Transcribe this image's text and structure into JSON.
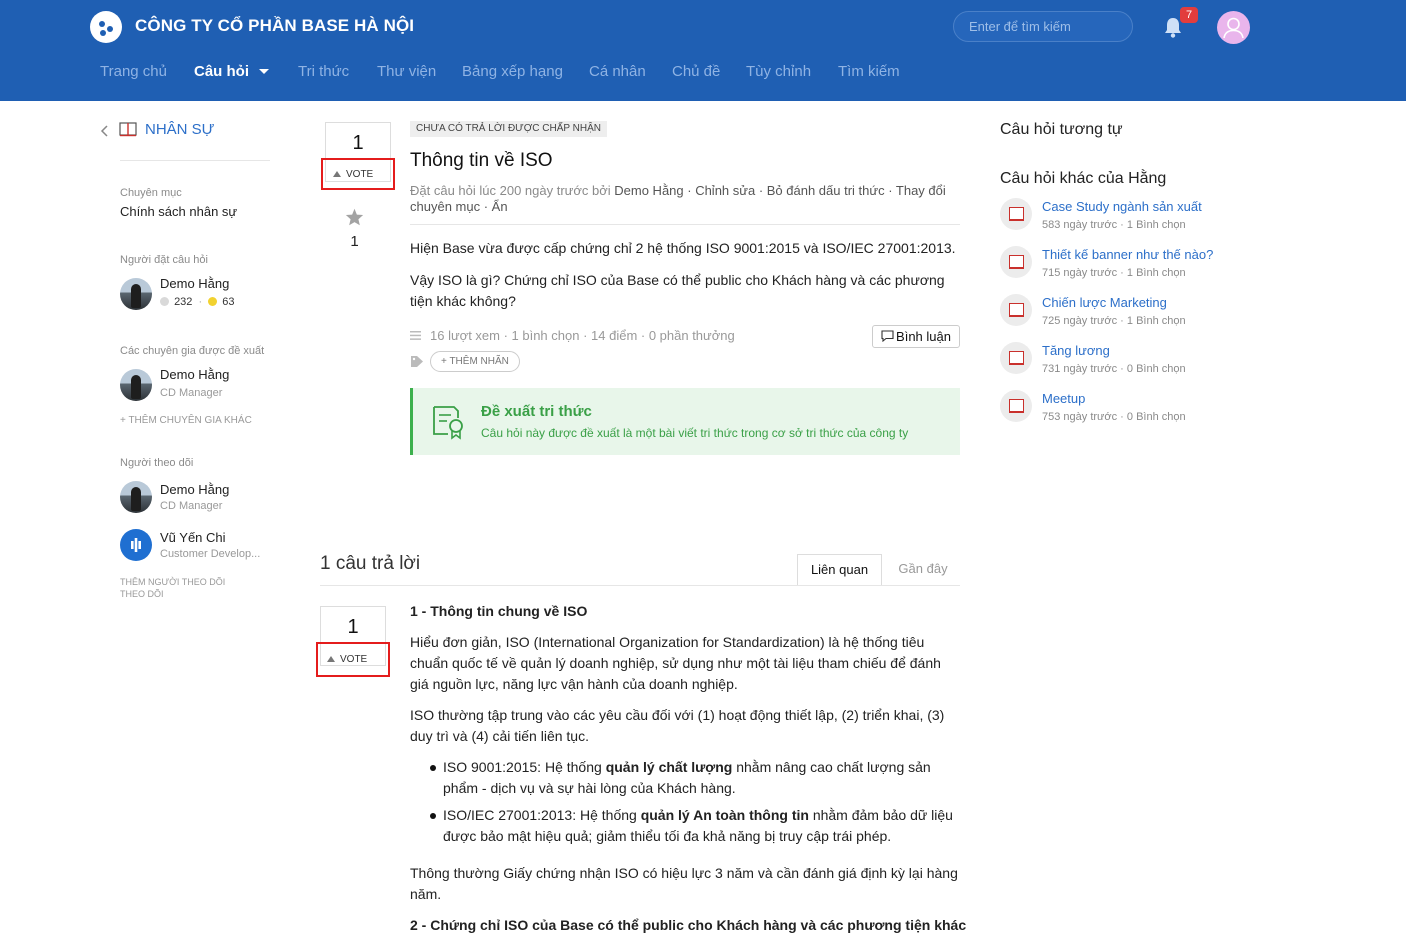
{
  "header": {
    "company": "CÔNG TY CỔ PHẦN BASE HÀ NỘI",
    "search_placeholder": "Enter để tìm kiếm",
    "notification_count": "7",
    "nav": [
      {
        "label": "Trang chủ"
      },
      {
        "label": "Câu hỏi"
      },
      {
        "label": "Tri thức"
      },
      {
        "label": "Thư viện"
      },
      {
        "label": "Bảng xếp hạng"
      },
      {
        "label": "Cá nhân"
      },
      {
        "label": "Chủ đề"
      },
      {
        "label": "Tùy chỉnh"
      },
      {
        "label": "Tìm kiếm"
      }
    ],
    "colors": {
      "bar": "#1f5fb3",
      "badge": "#e23d3d"
    }
  },
  "left": {
    "section_title": "NHÂN SỰ",
    "category_label": "Chuyên mục",
    "category_value": "Chính sách nhân sự",
    "asker_label": "Người đặt câu hỏi",
    "asker": {
      "name": "Demo Hằng",
      "points_a": "232",
      "points_b": "63"
    },
    "experts_label": "Các chuyên gia được đề xuất",
    "expert": {
      "name": "Demo Hằng",
      "role": "CD Manager"
    },
    "add_expert": "+ THÊM CHUYÊN GIA KHÁC",
    "followers_label": "Người theo dõi",
    "followers": [
      {
        "name": "Demo Hằng",
        "role": "CD Manager"
      },
      {
        "name": "Vũ Yến Chi",
        "role": "Customer Develop..."
      }
    ],
    "add_follower_1": "THÊM NGƯỜI THEO DÕI",
    "add_follower_2": "THEO DÕI"
  },
  "question": {
    "vote_count": "1",
    "vote_label": "VOTE",
    "star_count": "1",
    "status": "CHƯA CÓ TRẢ LỜI ĐƯỢC CHẤP NHẬN",
    "title": "Thông tin về ISO",
    "meta_prefix": "Đặt câu hỏi lúc 200 ngày trước bởi",
    "meta_author": "Demo Hằng",
    "meta_actions": " · Chỉnh sửa · Bỏ đánh dấu tri thức · Thay đổi chuyên mục · Ẩn",
    "body_1": "Hiện Base vừa được cấp chứng chỉ 2 hệ thống ISO 9001:2015 và ISO/IEC 27001:2013.",
    "body_2": "Vậy ISO là gì? Chứng chỉ ISO của Base có thể public cho Khách hàng và các phương tiện khác không?",
    "stats": "16 lượt xem · 1 bình chọn · 14 điểm · 0 phần thưởng",
    "comment_label": "Bình luận",
    "add_tag": "+ THÊM NHÃN",
    "suggest_title": "Đề xuất tri thức",
    "suggest_desc": "Câu hỏi này được đề xuất là một bài viết tri thức trong cơ sở tri thức của công ty"
  },
  "answers": {
    "count_label": "1 câu trả lời",
    "tabs": [
      {
        "label": "Liên quan"
      },
      {
        "label": "Gần đây"
      }
    ],
    "vote_count": "1",
    "vote_label": "VOTE",
    "h1": "1 - Thông tin chung về ISO",
    "p1": "Hiểu đơn giản, ISO (International Organization for Standardization) là hệ thống tiêu chuẩn quốc tế về quản lý doanh nghiệp, sử dụng như một tài liệu tham chiếu để đánh giá nguồn lực, năng lực vận hành của doanh nghiệp.",
    "p2": "ISO thường tập trung vào các yêu cầu đối với (1) hoạt động thiết lập, (2) triển khai, (3) duy trì và (4) cải tiến liên tục.",
    "b1_pre": "ISO 9001:2015: Hệ thống ",
    "b1_bold": "quản lý chất lượng",
    "b1_post": " nhằm nâng cao chất lượng sản phẩm - dịch vụ và sự hài lòng của Khách hàng.",
    "b2_pre": "ISO/IEC 27001:2013: Hệ thống ",
    "b2_bold": "quản lý An toàn thông tin",
    "b2_post": " nhằm đảm bảo dữ liệu được bảo mật hiệu quả; giảm thiểu tối đa khả năng bị truy cập trái phép.",
    "p3": "Thông thường Giấy chứng nhận ISO có hiệu lực 3 năm và cần đánh giá định kỳ lại hàng năm.",
    "h2": "2 - Chứng chỉ ISO của Base có thể public cho Khách hàng và các phương tiện khác"
  },
  "right": {
    "similar_title": "Câu hỏi tương tự",
    "other_title": "Câu hỏi khác của Hằng",
    "items": [
      {
        "title": "Case Study ngành sản xuất",
        "meta": "583 ngày trước · 1 Bình chọn"
      },
      {
        "title": "Thiết kế banner như thế nào?",
        "meta": "715 ngày trước · 1 Bình chọn"
      },
      {
        "title": "Chiến lược Marketing",
        "meta": "725 ngày trước · 1 Bình chọn"
      },
      {
        "title": "Tăng lương",
        "meta": "731 ngày trước · 0 Bình chọn"
      },
      {
        "title": "Meetup",
        "meta": "753 ngày trước · 0 Bình chọn"
      }
    ]
  }
}
